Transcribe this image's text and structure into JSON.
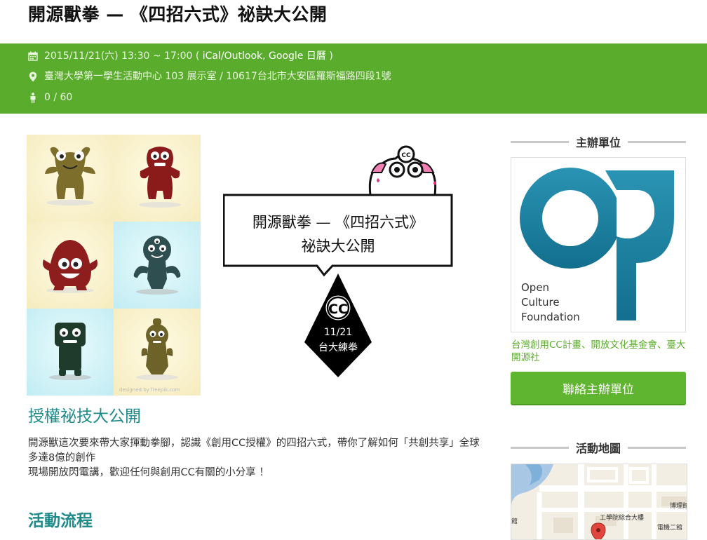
{
  "page": {
    "title": "開源獸拳 — 《四招六式》祕訣大公開"
  },
  "info": {
    "datetime": "2015/11/21(六) 13:30 ~ 17:00 (",
    "ical_link": "iCal/Outlook",
    "sep": ",",
    "google_link": "Google 日曆",
    "close": ")",
    "location": "臺灣大學第一學生活動中心 103 展示室 / 10617台北市大安區羅斯福路四段1號",
    "attendance": "0 / 60",
    "bar_color": "#5aac2c"
  },
  "illustration": {
    "bubble_line1": "開源獸拳 — 《四招六式》",
    "bubble_line2": "祕訣大公開",
    "badge_cc": "CC",
    "badge_date": "11/21",
    "badge_place": "台大練拳",
    "mascot_cc": "CC",
    "credit": "designed by freepik.com"
  },
  "content": {
    "heading1": "授權祕技大公開",
    "paragraph1": "開源獸這次要來帶大家揮動拳腳，認識《創用CC授權》的四招六式，帶你了解如何「共創共享」全球多達8億的創作",
    "paragraph2": "現場開放閃電講，歡迎任何與創用CC有關的小分享 ！",
    "heading2": "活動流程"
  },
  "sidebar": {
    "organizer_heading": "主辦單位",
    "org_logo_text": [
      "Open",
      "Culture",
      "Foundation"
    ],
    "org_names": "台灣創用CC計畫、開放文化基金會、臺大開源社",
    "contact_button": "聯絡主辦單位",
    "map_heading": "活動地圖",
    "map_labels": {
      "building1": "工學院綜合大樓",
      "building2": "博理館",
      "building3": "電機二館",
      "left": "館"
    }
  },
  "colors": {
    "accent_green": "#5aac2c",
    "heading_teal": "#1f8a8a",
    "logo_blue": "#1a7c9a"
  }
}
